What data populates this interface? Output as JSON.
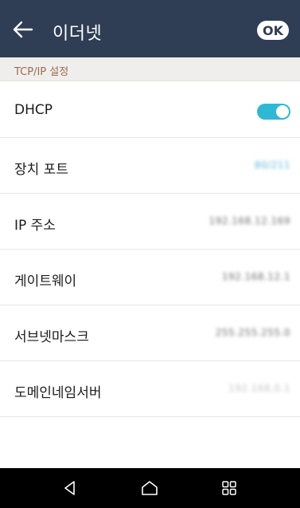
{
  "header": {
    "title": "이더넷",
    "ok_label": "OK",
    "icons": {
      "back": "arrow-left-icon"
    }
  },
  "section": {
    "title": "TCP/IP 설정"
  },
  "rows": [
    {
      "label": "DHCP",
      "toggle_on": true
    },
    {
      "label": "장치 포트",
      "value": "80/211"
    },
    {
      "label": "IP 주소",
      "value": "192.168.12.169"
    },
    {
      "label": "게이트웨이",
      "value": "192.168.12.1"
    },
    {
      "label": "서브넷마스크",
      "value": "255.255.255.0"
    },
    {
      "label": "도메인네임서버",
      "value": "192.168.0.1"
    }
  ],
  "navbar": {
    "icons": [
      "back-triangle-icon",
      "home-icon",
      "recents-grid-icon"
    ]
  },
  "colors": {
    "header_bg": "#2f3d55",
    "section_bg": "#efeeec",
    "section_text": "#9b6d4e",
    "toggle_on": "#2fb8d4",
    "navbar_bg": "#000000"
  }
}
